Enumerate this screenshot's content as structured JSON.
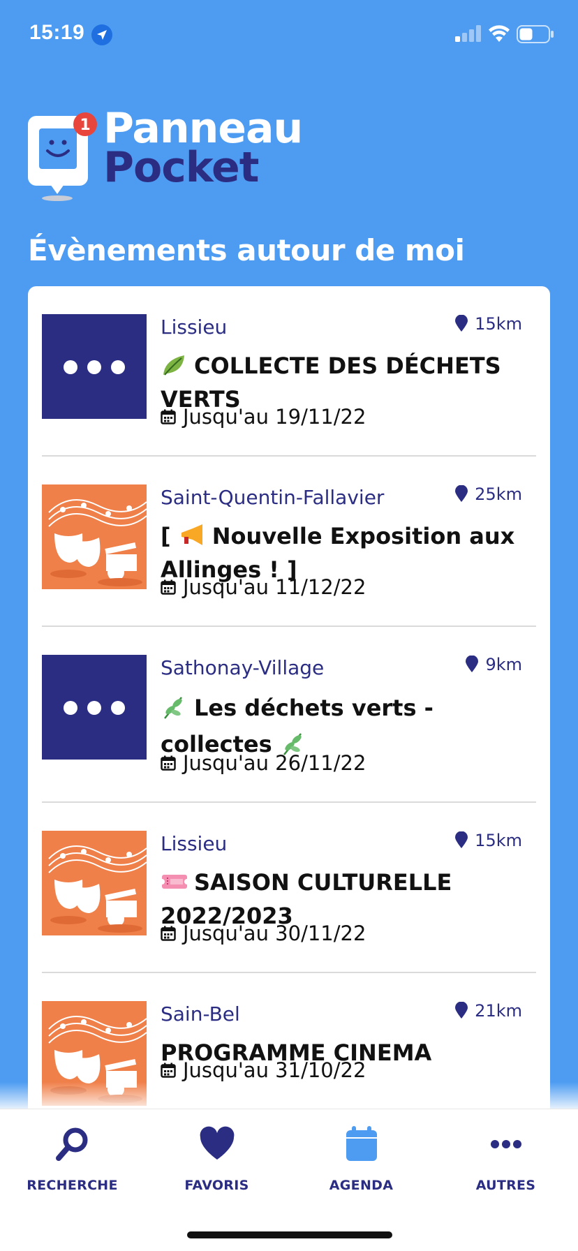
{
  "status_bar": {
    "time": "15:19"
  },
  "logo": {
    "line1": "Panneau",
    "line2": "Pocket",
    "badge": "1"
  },
  "section_title": "Évènements autour de moi",
  "events": [
    {
      "town": "Lissieu",
      "distance": "15km",
      "title": "COLLECTE DES DÉCHETS VERTS",
      "title_emoji": "leaf-emoji",
      "date": "Jusqu'au 19/11/22",
      "thumb": "dots"
    },
    {
      "town": "Saint-Quentin-Fallavier",
      "distance": "25km",
      "title_prefix": "[",
      "title": "Nouvelle Exposition aux Allinges ! ]",
      "title_emoji": "megaphone-emoji",
      "date": "Jusqu'au 11/12/22",
      "thumb": "culture"
    },
    {
      "town": "Sathonay-Village",
      "distance": "9km",
      "title": "Les déchets verts - collectes",
      "title_emoji": "herb-emoji",
      "date": "Jusqu'au 26/11/22",
      "thumb": "dots"
    },
    {
      "town": "Lissieu",
      "distance": "15km",
      "title": "SAISON CULTURELLE 2022/2023",
      "title_emoji": "ticket-emoji",
      "date": "Jusqu'au 30/11/22",
      "thumb": "culture"
    },
    {
      "town": "Sain-Bel",
      "distance": "21km",
      "title": "PROGRAMME CINEMA",
      "date": "Jusqu'au 31/10/22",
      "thumb": "culture"
    }
  ],
  "nav": {
    "search": "RECHERCHE",
    "favorites": "FAVORIS",
    "agenda": "AGENDA",
    "more": "AUTRES"
  },
  "colors": {
    "background": "#4d9cf2",
    "brand_dark": "#2b2d83",
    "culture_orange": "#f0804a",
    "badge_red": "#e8453c",
    "agenda_blue": "#4d9cf2"
  }
}
